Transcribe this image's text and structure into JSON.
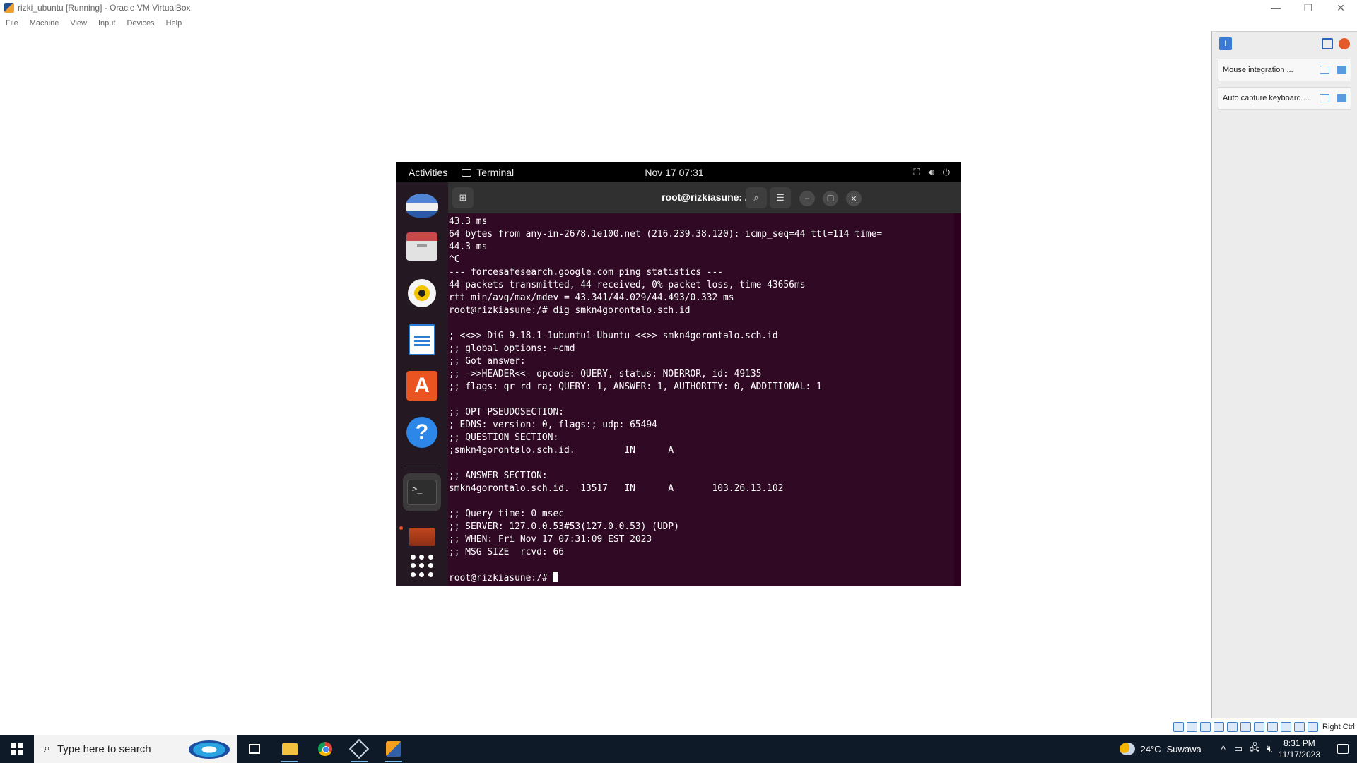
{
  "window": {
    "title": "rizki_ubuntu [Running] - Oracle VM VirtualBox",
    "controls": {
      "minimize": "—",
      "restore": "❐",
      "close": "✕"
    }
  },
  "menubar": [
    "File",
    "Machine",
    "View",
    "Input",
    "Devices",
    "Help"
  ],
  "notifications": {
    "items": [
      {
        "text": "Mouse integration ..."
      },
      {
        "text": "Auto capture keyboard ..."
      }
    ]
  },
  "statusbar": {
    "host_key": "Right Ctrl"
  },
  "guest": {
    "topbar": {
      "activities": "Activities",
      "app_name": "Terminal",
      "clock": "Nov 17  07:31"
    },
    "terminal": {
      "title": "root@rizkiasune: /",
      "lines": [
        "43.3 ms",
        "64 bytes from any-in-2678.1e100.net (216.239.38.120): icmp_seq=44 ttl=114 time=",
        "44.3 ms",
        "^C",
        "--- forcesafesearch.google.com ping statistics ---",
        "44 packets transmitted, 44 received, 0% packet loss, time 43656ms",
        "rtt min/avg/max/mdev = 43.341/44.029/44.493/0.332 ms",
        "root@rizkiasune:/# dig smkn4gorontalo.sch.id",
        "",
        "; <<>> DiG 9.18.1-1ubuntu1-Ubuntu <<>> smkn4gorontalo.sch.id",
        ";; global options: +cmd",
        ";; Got answer:",
        ";; ->>HEADER<<- opcode: QUERY, status: NOERROR, id: 49135",
        ";; flags: qr rd ra; QUERY: 1, ANSWER: 1, AUTHORITY: 0, ADDITIONAL: 1",
        "",
        ";; OPT PSEUDOSECTION:",
        "; EDNS: version: 0, flags:; udp: 65494",
        ";; QUESTION SECTION:",
        ";smkn4gorontalo.sch.id.         IN      A",
        "",
        ";; ANSWER SECTION:",
        "smkn4gorontalo.sch.id.  13517   IN      A       103.26.13.102",
        "",
        ";; Query time: 0 msec",
        ";; SERVER: 127.0.0.53#53(127.0.0.53) (UDP)",
        ";; WHEN: Fri Nov 17 07:31:09 EST 2023",
        ";; MSG SIZE  rcvd: 66",
        ""
      ],
      "prompt": "root@rizkiasune:/# "
    }
  },
  "taskbar": {
    "search_placeholder": "Type here to search",
    "weather": {
      "temp": "24°C",
      "location": "Suwawa"
    },
    "time": "8:31 PM",
    "date": "11/17/2023"
  },
  "colors": {
    "terminal_bg": "#300a24",
    "ubuntu_orange": "#e95420",
    "taskbar_bg": "#0f1a29"
  }
}
